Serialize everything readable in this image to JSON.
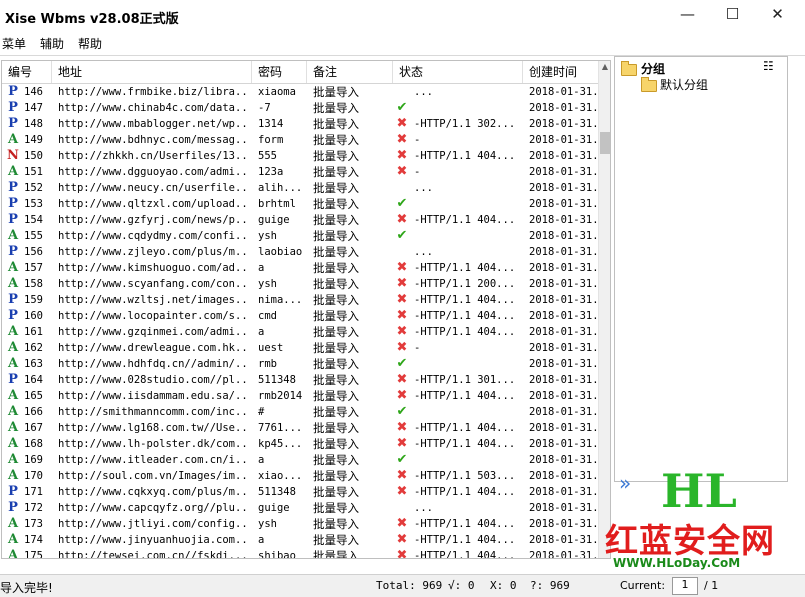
{
  "window": {
    "title": "Xise Wbms v28.08正式版",
    "minimize": "—",
    "maximize": "☐",
    "close": "✕"
  },
  "menu": [
    "菜单",
    "辅助",
    "帮助"
  ],
  "columns": [
    "编号",
    "地址",
    "密码",
    "备注",
    "状态",
    "创建时间"
  ],
  "rows": [
    {
      "t": "P",
      "id": "146",
      "url": "http://www.frmbike.biz/libra...",
      "pwd": "xiaoma",
      "note": "批量导入",
      "icon": "",
      "status": "...",
      "date": "2018-01-31..."
    },
    {
      "t": "P",
      "id": "147",
      "url": "http://www.chinab4c.com/data...",
      "pwd": "-7",
      "note": "批量导入",
      "icon": "ok",
      "status": "",
      "date": "2018-01-31..."
    },
    {
      "t": "P",
      "id": "148",
      "url": "http://www.mbablogger.net/wp...",
      "pwd": "1314",
      "note": "批量导入",
      "icon": "bad",
      "status": "-HTTP/1.1 302...",
      "date": "2018-01-31..."
    },
    {
      "t": "A",
      "id": "149",
      "url": "http://www.bdhnyc.com/messag...",
      "pwd": "form",
      "note": "批量导入",
      "icon": "bad",
      "status": "-",
      "date": "2018-01-31..."
    },
    {
      "t": "N",
      "id": "150",
      "url": "http://zhkkh.cn/Userfiles/13...",
      "pwd": "555",
      "note": "批量导入",
      "icon": "bad",
      "status": "-HTTP/1.1 404...",
      "date": "2018-01-31..."
    },
    {
      "t": "A",
      "id": "151",
      "url": "http://www.dgguoyao.com/admi...",
      "pwd": "123a",
      "note": "批量导入",
      "icon": "bad",
      "status": "-",
      "date": "2018-01-31..."
    },
    {
      "t": "P",
      "id": "152",
      "url": "http://www.neucy.cn/userfile...",
      "pwd": "alih...",
      "note": "批量导入",
      "icon": "",
      "status": "...",
      "date": "2018-01-31..."
    },
    {
      "t": "P",
      "id": "153",
      "url": "http://www.qltzxl.com/upload...",
      "pwd": "brhtml",
      "note": "批量导入",
      "icon": "ok",
      "status": "",
      "date": "2018-01-31..."
    },
    {
      "t": "P",
      "id": "154",
      "url": "http://www.gzfyrj.com/news/p...",
      "pwd": "guige",
      "note": "批量导入",
      "icon": "bad",
      "status": "-HTTP/1.1 404...",
      "date": "2018-01-31..."
    },
    {
      "t": "A",
      "id": "155",
      "url": "http://www.cqdydmy.com/confi...",
      "pwd": "ysh",
      "note": "批量导入",
      "icon": "ok",
      "status": "",
      "date": "2018-01-31..."
    },
    {
      "t": "P",
      "id": "156",
      "url": "http://www.zjleyo.com/plus/m...",
      "pwd": "laobiao",
      "note": "批量导入",
      "icon": "",
      "status": "...",
      "date": "2018-01-31..."
    },
    {
      "t": "A",
      "id": "157",
      "url": "http://www.kimshuoguo.com/ad...",
      "pwd": "a",
      "note": "批量导入",
      "icon": "bad",
      "status": "-HTTP/1.1 404...",
      "date": "2018-01-31..."
    },
    {
      "t": "A",
      "id": "158",
      "url": "http://www.scyanfang.com/con...",
      "pwd": "ysh",
      "note": "批量导入",
      "icon": "bad",
      "status": "-HTTP/1.1 200...",
      "date": "2018-01-31..."
    },
    {
      "t": "P",
      "id": "159",
      "url": "http://www.wzltsj.net/images...",
      "pwd": "nima...",
      "note": "批量导入",
      "icon": "bad",
      "status": "-HTTP/1.1 404...",
      "date": "2018-01-31..."
    },
    {
      "t": "P",
      "id": "160",
      "url": "http://www.locopainter.com/s...",
      "pwd": "cmd",
      "note": "批量导入",
      "icon": "bad",
      "status": "-HTTP/1.1 404...",
      "date": "2018-01-31..."
    },
    {
      "t": "A",
      "id": "161",
      "url": "http://www.gzqinmei.com/admi...",
      "pwd": "a",
      "note": "批量导入",
      "icon": "bad",
      "status": "-HTTP/1.1 404...",
      "date": "2018-01-31..."
    },
    {
      "t": "A",
      "id": "162",
      "url": "http://www.drewleague.com.hk...",
      "pwd": "uest",
      "note": "批量导入",
      "icon": "bad",
      "status": "-",
      "date": "2018-01-31..."
    },
    {
      "t": "A",
      "id": "163",
      "url": "http://www.hdhfdq.cn//admin/...",
      "pwd": "rmb",
      "note": "批量导入",
      "icon": "ok",
      "status": "",
      "date": "2018-01-31..."
    },
    {
      "t": "P",
      "id": "164",
      "url": "http://www.028studio.com//pl...",
      "pwd": "511348",
      "note": "批量导入",
      "icon": "bad",
      "status": "-HTTP/1.1 301...",
      "date": "2018-01-31..."
    },
    {
      "t": "A",
      "id": "165",
      "url": "http://www.iisdammam.edu.sa/...",
      "pwd": "rmb2014",
      "note": "批量导入",
      "icon": "bad",
      "status": "-HTTP/1.1 404...",
      "date": "2018-01-31..."
    },
    {
      "t": "A",
      "id": "166",
      "url": "http://smithmanncomm.com/inc...",
      "pwd": "#",
      "note": "批量导入",
      "icon": "ok",
      "status": "",
      "date": "2018-01-31..."
    },
    {
      "t": "A",
      "id": "167",
      "url": "http://www.lg168.com.tw//Use...",
      "pwd": "7761...",
      "note": "批量导入",
      "icon": "bad",
      "status": "-HTTP/1.1 404...",
      "date": "2018-01-31..."
    },
    {
      "t": "A",
      "id": "168",
      "url": "http://www.lh-polster.dk/com...",
      "pwd": "kp45...",
      "note": "批量导入",
      "icon": "bad",
      "status": "-HTTP/1.1 404...",
      "date": "2018-01-31..."
    },
    {
      "t": "A",
      "id": "169",
      "url": "http://www.itleader.com.cn/i...",
      "pwd": "a",
      "note": "批量导入",
      "icon": "ok",
      "status": "",
      "date": "2018-01-31..."
    },
    {
      "t": "A",
      "id": "170",
      "url": "http://soul.com.vn/Images/im...",
      "pwd": "xiao...",
      "note": "批量导入",
      "icon": "bad",
      "status": "-HTTP/1.1 503...",
      "date": "2018-01-31..."
    },
    {
      "t": "P",
      "id": "171",
      "url": "http://www.cqkxyq.com/plus/m...",
      "pwd": "511348",
      "note": "批量导入",
      "icon": "bad",
      "status": "-HTTP/1.1 404...",
      "date": "2018-01-31..."
    },
    {
      "t": "P",
      "id": "172",
      "url": "http://www.capcqyfz.org//plu...",
      "pwd": "guige",
      "note": "批量导入",
      "icon": "",
      "status": "...",
      "date": "2018-01-31..."
    },
    {
      "t": "A",
      "id": "173",
      "url": "http://www.jtliyi.com/config...",
      "pwd": "ysh",
      "note": "批量导入",
      "icon": "bad",
      "status": "-HTTP/1.1 404...",
      "date": "2018-01-31..."
    },
    {
      "t": "A",
      "id": "174",
      "url": "http://www.jinyuanhuojia.com...",
      "pwd": "a",
      "note": "批量导入",
      "icon": "bad",
      "status": "-HTTP/1.1 404...",
      "date": "2018-01-31..."
    },
    {
      "t": "A",
      "id": "175",
      "url": "http://tewsei.com.cn//fskdi...",
      "pwd": "shibao",
      "note": "批量导入",
      "icon": "bad",
      "status": "-HTTP/1.1 404...",
      "date": "2018-01-31..."
    }
  ],
  "tree": {
    "root": "分组",
    "child": "默认分组"
  },
  "status": {
    "message": "导入完毕!",
    "total": "Total: 969",
    "ok": "√: 0",
    "bad": "X: 0",
    "unknown": "?: 969",
    "current": "Current:",
    "page": "1",
    "pages": "/ 1"
  },
  "watermark": {
    "hl": "HL",
    "name": "红蓝安全网",
    "url": "WWW.HLoDay.CoM"
  },
  "colors": {
    "ok": "#2ea619",
    "bad": "#e23b3b",
    "type_P": "#1a3fb0",
    "type_A": "#1f8a34",
    "type_N": "#c42020"
  }
}
